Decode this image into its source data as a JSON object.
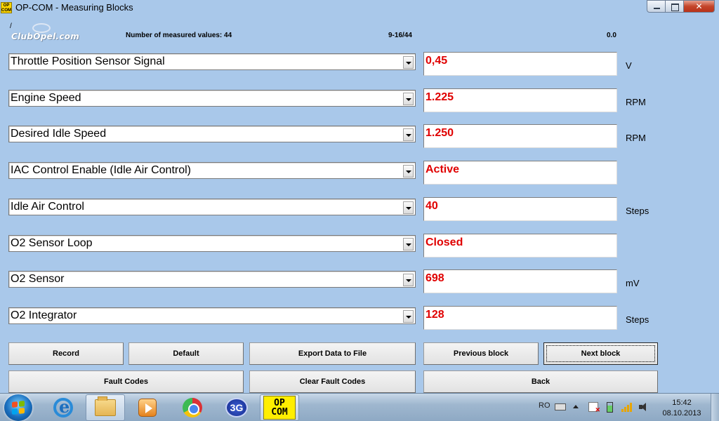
{
  "window": {
    "title": "OP-COM - Measuring Blocks",
    "app_icon_text": "OP COM"
  },
  "header": {
    "slash": "/",
    "logo_text": "ClubOpel.com",
    "measured_label": "Number of measured values: 44",
    "range": "9-16/44",
    "counter": "0.0"
  },
  "rows": [
    {
      "label": "Throttle Position Sensor Signal",
      "value": "0,45",
      "unit": "V"
    },
    {
      "label": "Engine Speed",
      "value": "1.225",
      "unit": "RPM"
    },
    {
      "label": "Desired Idle Speed",
      "value": "1.250",
      "unit": "RPM"
    },
    {
      "label": "IAC Control Enable (Idle Air Control)",
      "value": "Active",
      "unit": ""
    },
    {
      "label": "Idle Air Control",
      "value": "40",
      "unit": "Steps"
    },
    {
      "label": "O2 Sensor Loop",
      "value": "Closed",
      "unit": ""
    },
    {
      "label": "O2 Sensor",
      "value": "698",
      "unit": "mV"
    },
    {
      "label": "O2 Integrator",
      "value": "128",
      "unit": "Steps"
    }
  ],
  "buttons": {
    "record": "Record",
    "default": "Default",
    "export": "Export Data to File",
    "previous": "Previous block",
    "next": "Next block",
    "fault_codes": "Fault Codes",
    "clear_fault_codes": "Clear Fault Codes",
    "back": "Back"
  },
  "taskbar": {
    "g3_label": "3G",
    "opcom_line1": "OP",
    "opcom_line2": "COM",
    "language": "RO",
    "time": "15:42",
    "date": "08.10.2013"
  }
}
